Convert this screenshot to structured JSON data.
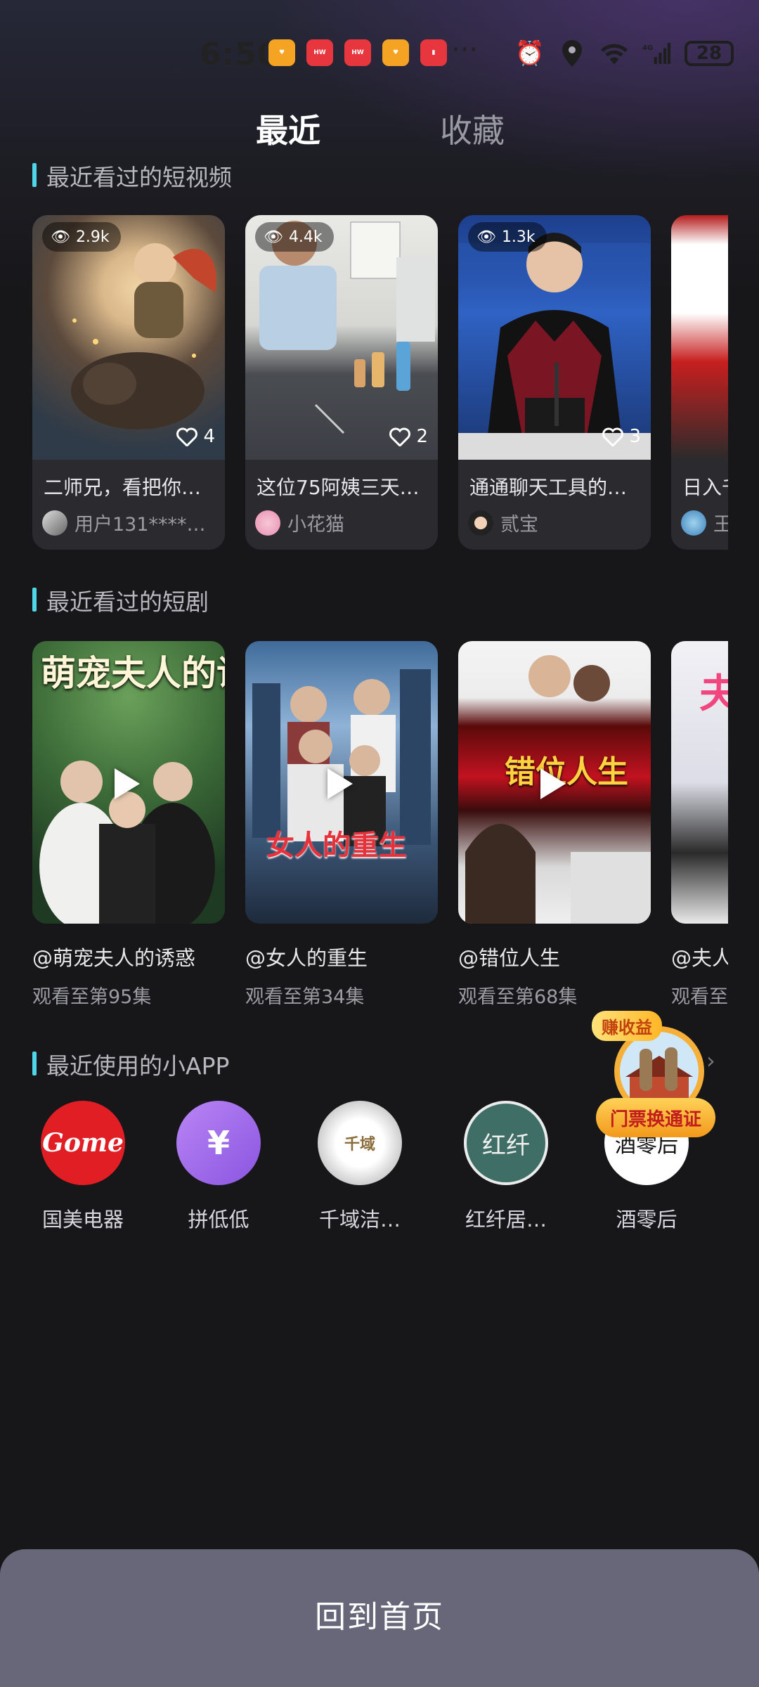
{
  "status_bar": {
    "time": "6:50",
    "network": "4G",
    "battery": "28"
  },
  "tabs": [
    {
      "label": "最近",
      "active": true
    },
    {
      "label": "收藏",
      "active": false
    }
  ],
  "sections": {
    "short_videos": "最近看过的短视频",
    "short_dramas": "最近看过的短剧",
    "mini_apps": "最近使用的小APP"
  },
  "videos": [
    {
      "views": "2.9k",
      "likes": "4",
      "title": "二师兄，看把你…",
      "user": "用户131****…"
    },
    {
      "views": "4.4k",
      "likes": "2",
      "title": "这位75阿姨三天…",
      "user": "小花猫"
    },
    {
      "views": "1.3k",
      "likes": "3",
      "title": "通通聊天工具的…",
      "user": "贰宝"
    },
    {
      "views": "",
      "likes": "",
      "title": "日入千",
      "user": "王"
    }
  ],
  "dramas": [
    {
      "name": "@萌宠夫人的诱惑",
      "progress": "观看至第95集",
      "poster_title": "萌宠夫人的诱惑"
    },
    {
      "name": "@女人的重生",
      "progress": "观看至第34集",
      "poster_title": "女人的重生"
    },
    {
      "name": "@错位人生",
      "progress": "观看至第68集",
      "poster_title": "错位人生"
    },
    {
      "name": "@夫人",
      "progress": "观看至",
      "poster_title": "夫"
    }
  ],
  "apps": [
    {
      "label": "国美电器",
      "icon_text": "Gome"
    },
    {
      "label": "拼低低",
      "icon_text": "¥"
    },
    {
      "label": "千域洁…",
      "icon_text": "千域"
    },
    {
      "label": "红纤居…",
      "icon_text": "红纤"
    },
    {
      "label": "酒零后",
      "icon_text": "酒零后"
    }
  ],
  "promo": {
    "top_text": "赚收益",
    "button_text": "门票换通证"
  },
  "bottom_button": "回到首页",
  "colors": {
    "accent": "#4fd6e8",
    "background": "#17171a",
    "card": "#2a2a2f",
    "bottom_bar": "#676779"
  }
}
